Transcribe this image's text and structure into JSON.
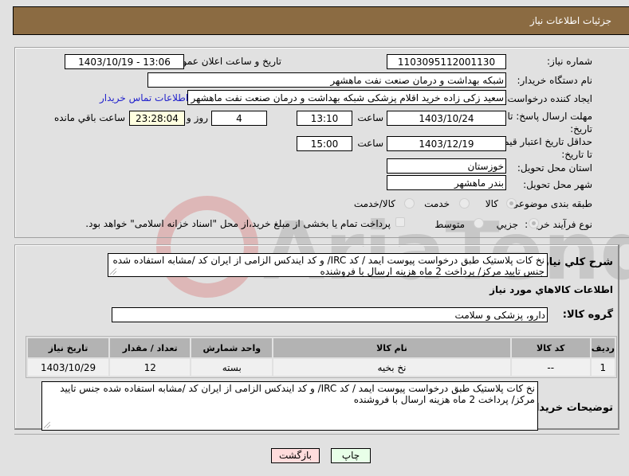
{
  "header": {
    "title": "جزئيات اطلاعات نياز"
  },
  "fields": {
    "need_number": {
      "label": "شماره نياز:",
      "value": "1103095112001130"
    },
    "announce_datetime": {
      "label": "تاريخ و ساعت اعلان عمومي:",
      "value": "1403/10/19 - 13:06"
    },
    "buyer_org": {
      "label": "نام دستگاه خريدار:",
      "value": "شبکه بهداشت و درمان صنعت نفت ماهشهر"
    },
    "requester": {
      "label": "ايجاد کننده درخواست:",
      "value": "سعيد زکی زاده خريد اقلام پزشکی شبکه بهداشت و درمان صنعت نفت ماهشهر"
    },
    "buyer_contact_link": "اطلاعات تماس خريدار",
    "reply_deadline": {
      "label": "مهلت ارسال پاسخ: تا تاريخ:",
      "date": "1403/10/24",
      "time_label": "ساعت",
      "time": "13:10",
      "days": "4",
      "days_label": "روز و",
      "remaining": "23:28:04",
      "remaining_label": "ساعت باقي مانده"
    },
    "price_validity": {
      "label": "حداقل تاريخ اعتبار قيمت: تا تاريخ:",
      "date": "1403/12/19",
      "time_label": "ساعت",
      "time": "15:00"
    },
    "province": {
      "label": "استان محل تحويل:",
      "value": "خوزستان"
    },
    "city": {
      "label": "شهر محل تحويل:",
      "value": "بندر ماهشهر"
    },
    "category": {
      "label": "طبقه بندی موضوعی:",
      "options": [
        "کالا",
        "خدمت",
        "کالا/خدمت"
      ],
      "selected": "کالا"
    },
    "purchase_type": {
      "label": "نوع فرآيند خريد :",
      "options": [
        "جزيي",
        "متوسط"
      ],
      "selected": "جزيي",
      "treasury_note": "پرداخت تمام يا بخشی از مبلغ خريد،از محل \"اسناد خزانه اسلامی\" خواهد بود."
    }
  },
  "description": {
    "label": "شرح کلي نياز:",
    "value": "نخ کات پلاستيک طبق درخواست پيوست ايمد / کد IRC/ و کد ايندکس الزامی از ايران کد /مشابه استفاده شده جنس تاييد مرکز/ پرداخت 2 ماه هزينه ارسال با فروشنده"
  },
  "goods_section_title": "اطلاعات کالاهاي مورد نياز",
  "goods_group": {
    "label": "گروه کالا:",
    "value": "دارو، پزشکی و سلامت"
  },
  "table": {
    "headers": [
      "رديف",
      "کد کالا",
      "نام کالا",
      "واحد شمارش",
      "تعداد / مقدار",
      "تاريخ نياز"
    ],
    "rows": [
      [
        "1",
        "--",
        "نخ بخيه",
        "بسته",
        "12",
        "1403/10/29"
      ]
    ]
  },
  "buyer_notes": {
    "label": "توضيحات خريدار:",
    "value": "نخ کات پلاستيک طبق درخواست پيوست ايمد / کد IRC/ و کد ايندکس الزامی از ايران کد /مشابه استفاده شده جنس تاييد مرکز/ پرداخت 2 ماه هزينه ارسال با فروشنده"
  },
  "buttons": {
    "print": "چاپ",
    "back": "بازگشت"
  },
  "watermark": "AriaTender.net"
}
